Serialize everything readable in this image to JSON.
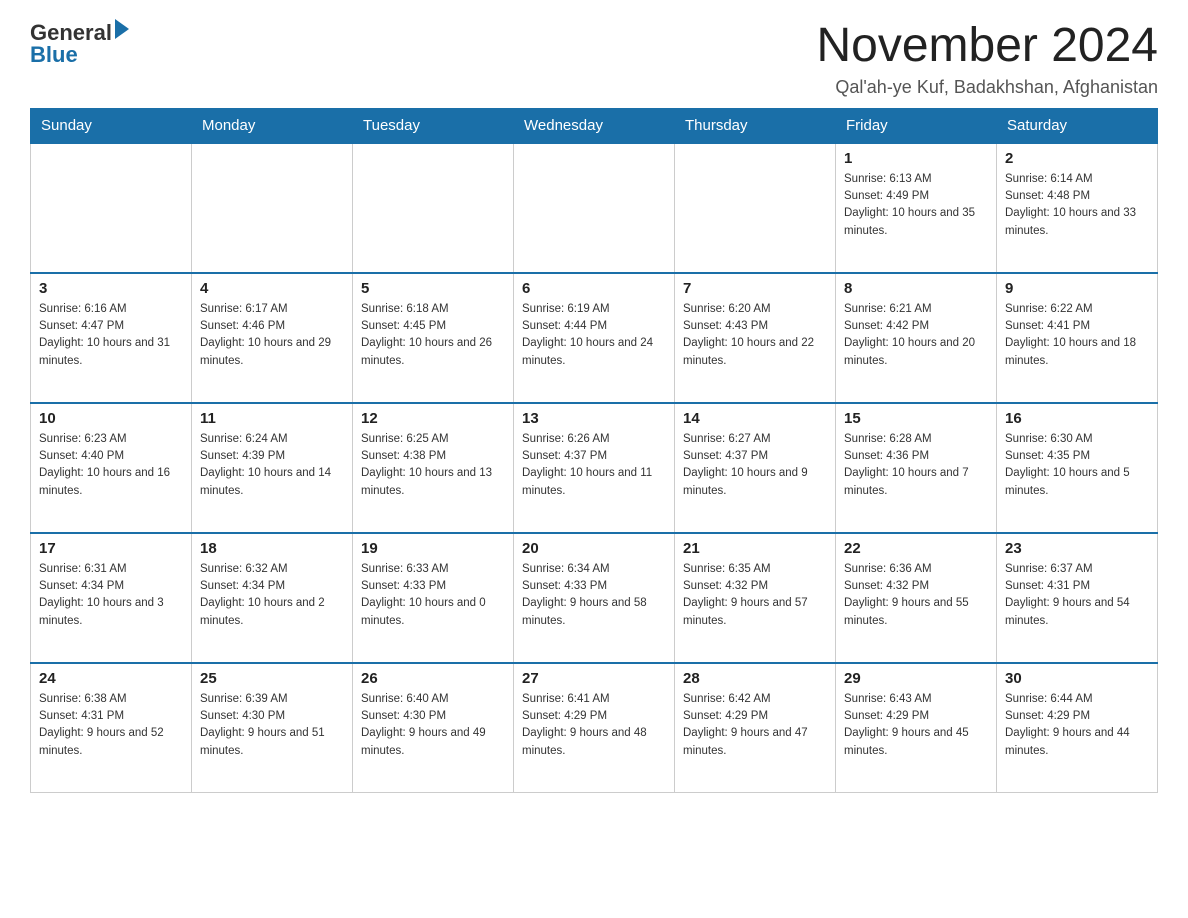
{
  "logo": {
    "general": "General",
    "blue": "Blue"
  },
  "header": {
    "month_year": "November 2024",
    "location": "Qal'ah-ye Kuf, Badakhshan, Afghanistan"
  },
  "days_of_week": [
    "Sunday",
    "Monday",
    "Tuesday",
    "Wednesday",
    "Thursday",
    "Friday",
    "Saturday"
  ],
  "weeks": [
    [
      {
        "day": "",
        "info": ""
      },
      {
        "day": "",
        "info": ""
      },
      {
        "day": "",
        "info": ""
      },
      {
        "day": "",
        "info": ""
      },
      {
        "day": "",
        "info": ""
      },
      {
        "day": "1",
        "info": "Sunrise: 6:13 AM\nSunset: 4:49 PM\nDaylight: 10 hours and 35 minutes."
      },
      {
        "day": "2",
        "info": "Sunrise: 6:14 AM\nSunset: 4:48 PM\nDaylight: 10 hours and 33 minutes."
      }
    ],
    [
      {
        "day": "3",
        "info": "Sunrise: 6:16 AM\nSunset: 4:47 PM\nDaylight: 10 hours and 31 minutes."
      },
      {
        "day": "4",
        "info": "Sunrise: 6:17 AM\nSunset: 4:46 PM\nDaylight: 10 hours and 29 minutes."
      },
      {
        "day": "5",
        "info": "Sunrise: 6:18 AM\nSunset: 4:45 PM\nDaylight: 10 hours and 26 minutes."
      },
      {
        "day": "6",
        "info": "Sunrise: 6:19 AM\nSunset: 4:44 PM\nDaylight: 10 hours and 24 minutes."
      },
      {
        "day": "7",
        "info": "Sunrise: 6:20 AM\nSunset: 4:43 PM\nDaylight: 10 hours and 22 minutes."
      },
      {
        "day": "8",
        "info": "Sunrise: 6:21 AM\nSunset: 4:42 PM\nDaylight: 10 hours and 20 minutes."
      },
      {
        "day": "9",
        "info": "Sunrise: 6:22 AM\nSunset: 4:41 PM\nDaylight: 10 hours and 18 minutes."
      }
    ],
    [
      {
        "day": "10",
        "info": "Sunrise: 6:23 AM\nSunset: 4:40 PM\nDaylight: 10 hours and 16 minutes."
      },
      {
        "day": "11",
        "info": "Sunrise: 6:24 AM\nSunset: 4:39 PM\nDaylight: 10 hours and 14 minutes."
      },
      {
        "day": "12",
        "info": "Sunrise: 6:25 AM\nSunset: 4:38 PM\nDaylight: 10 hours and 13 minutes."
      },
      {
        "day": "13",
        "info": "Sunrise: 6:26 AM\nSunset: 4:37 PM\nDaylight: 10 hours and 11 minutes."
      },
      {
        "day": "14",
        "info": "Sunrise: 6:27 AM\nSunset: 4:37 PM\nDaylight: 10 hours and 9 minutes."
      },
      {
        "day": "15",
        "info": "Sunrise: 6:28 AM\nSunset: 4:36 PM\nDaylight: 10 hours and 7 minutes."
      },
      {
        "day": "16",
        "info": "Sunrise: 6:30 AM\nSunset: 4:35 PM\nDaylight: 10 hours and 5 minutes."
      }
    ],
    [
      {
        "day": "17",
        "info": "Sunrise: 6:31 AM\nSunset: 4:34 PM\nDaylight: 10 hours and 3 minutes."
      },
      {
        "day": "18",
        "info": "Sunrise: 6:32 AM\nSunset: 4:34 PM\nDaylight: 10 hours and 2 minutes."
      },
      {
        "day": "19",
        "info": "Sunrise: 6:33 AM\nSunset: 4:33 PM\nDaylight: 10 hours and 0 minutes."
      },
      {
        "day": "20",
        "info": "Sunrise: 6:34 AM\nSunset: 4:33 PM\nDaylight: 9 hours and 58 minutes."
      },
      {
        "day": "21",
        "info": "Sunrise: 6:35 AM\nSunset: 4:32 PM\nDaylight: 9 hours and 57 minutes."
      },
      {
        "day": "22",
        "info": "Sunrise: 6:36 AM\nSunset: 4:32 PM\nDaylight: 9 hours and 55 minutes."
      },
      {
        "day": "23",
        "info": "Sunrise: 6:37 AM\nSunset: 4:31 PM\nDaylight: 9 hours and 54 minutes."
      }
    ],
    [
      {
        "day": "24",
        "info": "Sunrise: 6:38 AM\nSunset: 4:31 PM\nDaylight: 9 hours and 52 minutes."
      },
      {
        "day": "25",
        "info": "Sunrise: 6:39 AM\nSunset: 4:30 PM\nDaylight: 9 hours and 51 minutes."
      },
      {
        "day": "26",
        "info": "Sunrise: 6:40 AM\nSunset: 4:30 PM\nDaylight: 9 hours and 49 minutes."
      },
      {
        "day": "27",
        "info": "Sunrise: 6:41 AM\nSunset: 4:29 PM\nDaylight: 9 hours and 48 minutes."
      },
      {
        "day": "28",
        "info": "Sunrise: 6:42 AM\nSunset: 4:29 PM\nDaylight: 9 hours and 47 minutes."
      },
      {
        "day": "29",
        "info": "Sunrise: 6:43 AM\nSunset: 4:29 PM\nDaylight: 9 hours and 45 minutes."
      },
      {
        "day": "30",
        "info": "Sunrise: 6:44 AM\nSunset: 4:29 PM\nDaylight: 9 hours and 44 minutes."
      }
    ]
  ]
}
